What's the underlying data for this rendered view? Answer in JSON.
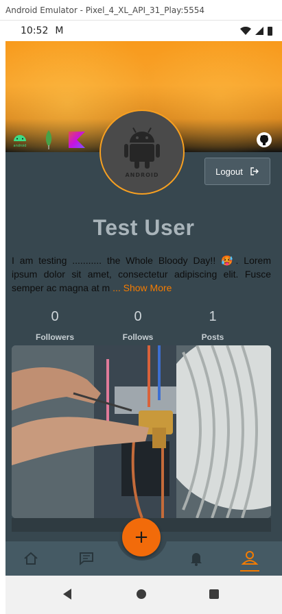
{
  "window": {
    "title": "Android Emulator - Pixel_4_XL_API_31_Play:5554"
  },
  "status_bar": {
    "time": "10:52",
    "mail_glyph": "M"
  },
  "header": {
    "tech_icons": [
      "android-icon",
      "mongodb-icon",
      "kotlin-icon"
    ],
    "android_badge_text": "android",
    "github_icon": "github-icon"
  },
  "profile": {
    "avatar_text": "ANDROID",
    "logout_label": "Logout",
    "name": "Test User",
    "bio_text": "I am testing ........... the Whole Bloody Day!! 🥵. Lorem ipsum dolor sit amet, consectetur adipiscing elit. Fusce semper ac magna at m",
    "show_more": "... Show More"
  },
  "stats": [
    {
      "value": "0",
      "label": "Followers"
    },
    {
      "value": "0",
      "label": "Follows"
    },
    {
      "value": "1",
      "label": "Posts"
    }
  ],
  "post": {
    "image_desc_icon": "photo"
  },
  "bottom_nav": {
    "items": [
      "home-icon",
      "chat-icon",
      "notification-icon",
      "profile-icon"
    ],
    "active": "profile-icon",
    "fab_label": "+"
  },
  "colors": {
    "accent": "#f57c00",
    "background": "#37474f",
    "nav": "#455a64"
  }
}
